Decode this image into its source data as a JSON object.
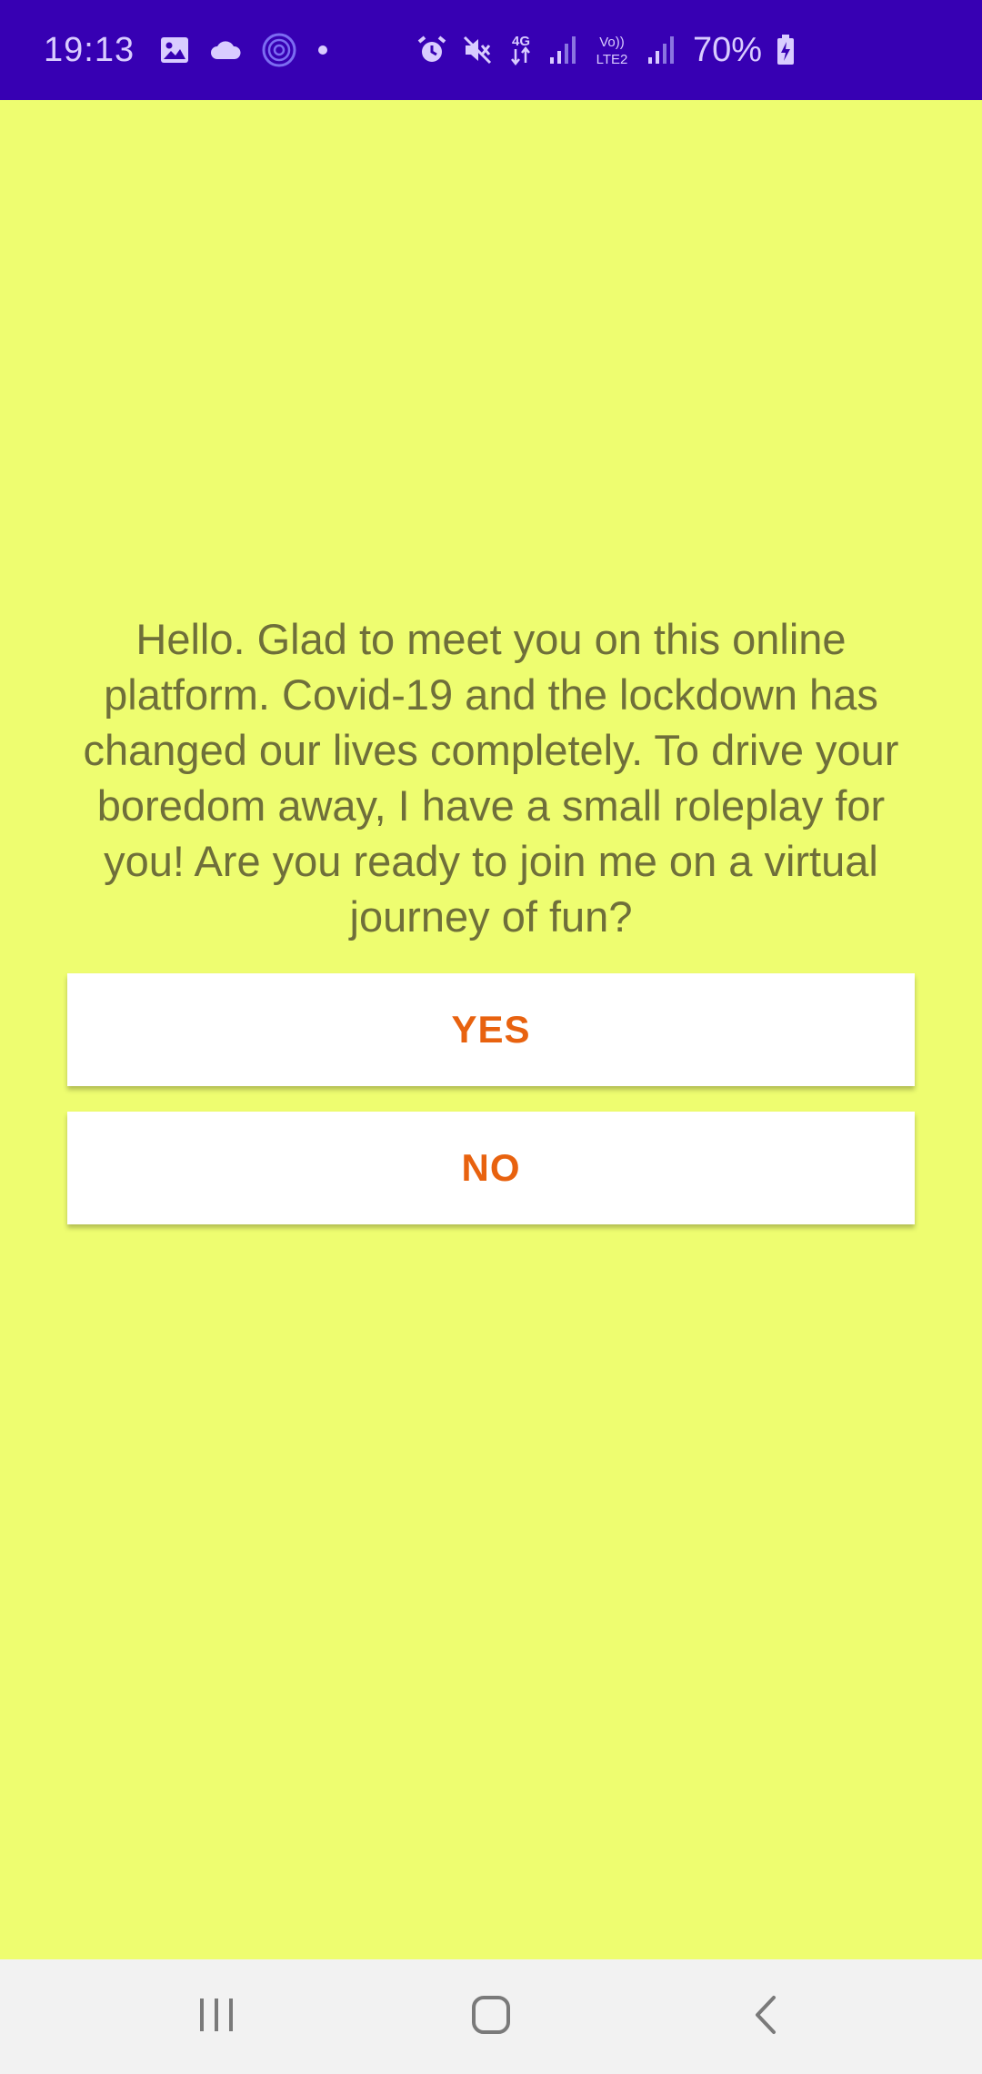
{
  "status_bar": {
    "time": "19:13",
    "battery": "70%",
    "background": "#3700b3",
    "icons_left": [
      "gallery-icon",
      "cloud-icon",
      "fingerprint-circle-icon",
      "dot-icon"
    ],
    "icons_right": [
      "alarm-icon",
      "mute-icon",
      "4g-data-icon",
      "signal-icon",
      "volte-lte2-icon",
      "signal-2-icon",
      "battery-charging-icon"
    ],
    "network_label": "4G",
    "volte_label_top": "Vo))",
    "volte_label_bottom": "LTE2"
  },
  "main": {
    "background": "#eefd70",
    "message": "Hello. Glad to meet you on this online platform. Covid-19 and the lockdown has changed our lives completely. To drive your boredom away, I have a small roleplay for you! Are you ready to join me on a virtual journey of fun?",
    "yes_label": "YES",
    "no_label": "NO",
    "button_text_color": "#e8620f"
  },
  "nav_bar": {
    "icons": [
      "recents-icon",
      "home-icon",
      "back-icon"
    ]
  }
}
